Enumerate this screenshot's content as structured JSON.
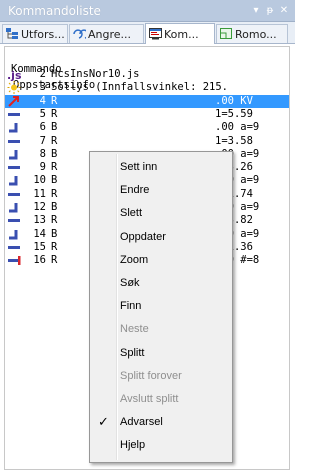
{
  "window": {
    "title": "Kommandoliste",
    "dropdown_icon": "▾",
    "pin_icon": "ᵽ",
    "close_icon": "✕"
  },
  "tabs": [
    {
      "label": "Utfors...",
      "icon": "tree-icon"
    },
    {
      "label": "Angre...",
      "icon": "undo-list-icon"
    },
    {
      "label": "Kom...",
      "icon": "command-list-icon",
      "active": true
    },
    {
      "label": "Romo...",
      "icon": "room-icon"
    }
  ],
  "list": {
    "header": "Kommando",
    "section": "Oppstartsinfo",
    "rows": [
      {
        "num": "2",
        "text": "HcsInsNor10.js",
        "tail": "",
        "icon": "js-icon"
      },
      {
        "num": "3",
        "text": "Sollys (Innfallsvinkel: 215.",
        "tail": "",
        "icon": "sun-icon"
      },
      {
        "num": "4",
        "text": "R",
        "tail": ".00 KV",
        "icon": "arrow-icon",
        "selected": true
      },
      {
        "num": "5",
        "text": "R",
        "tail": "1=5.59",
        "icon": "wall-icon"
      },
      {
        "num": "6",
        "text": "B",
        "tail": ".00 a=9",
        "icon": "bend-icon"
      },
      {
        "num": "7",
        "text": "R",
        "tail": "1=3.58",
        "icon": "wall-icon"
      },
      {
        "num": "8",
        "text": "B",
        "tail": ".00 a=9",
        "icon": "bend-icon"
      },
      {
        "num": "9",
        "text": "R",
        "tail": "1=3.26",
        "icon": "wall-icon"
      },
      {
        "num": "10",
        "text": "B",
        "tail": ".00 a=9",
        "icon": "bend-icon"
      },
      {
        "num": "11",
        "text": "R",
        "tail": "1=1.74",
        "icon": "wall-icon"
      },
      {
        "num": "12",
        "text": "B",
        "tail": ".00 a=9",
        "icon": "bend-icon"
      },
      {
        "num": "13",
        "text": "R",
        "tail": "1=3.82",
        "icon": "wall-icon"
      },
      {
        "num": "14",
        "text": "B",
        "tail": ".00 a=9",
        "icon": "bend-icon"
      },
      {
        "num": "15",
        "text": "R",
        "tail": "1=1.36",
        "icon": "wall-icon"
      },
      {
        "num": "16",
        "text": "R",
        "tail": ".00 #=8",
        "icon": "end-icon"
      }
    ]
  },
  "context_menu": {
    "items": [
      {
        "label": "Sett inn",
        "enabled": true
      },
      {
        "label": "Endre",
        "enabled": true
      },
      {
        "label": "Slett",
        "enabled": true
      },
      {
        "label": "Oppdater",
        "enabled": true
      },
      {
        "label": "Zoom",
        "enabled": true
      },
      {
        "label": "Søk",
        "enabled": true
      },
      {
        "label": "Finn",
        "enabled": true
      },
      {
        "label": "Neste",
        "enabled": false
      },
      {
        "label": "Splitt",
        "enabled": true
      },
      {
        "label": "Splitt forover",
        "enabled": false
      },
      {
        "label": "Avslutt splitt",
        "enabled": false
      },
      {
        "label": "Advarsel",
        "enabled": true,
        "checked": true
      },
      {
        "label": "Hjelp",
        "enabled": true
      }
    ],
    "check_glyph": "✓"
  },
  "colors": {
    "selection": "#3399ff",
    "titlebar": "#b9c9df",
    "wall_icon": "#3a4fb0",
    "end_icon_red": "#d8262c"
  }
}
